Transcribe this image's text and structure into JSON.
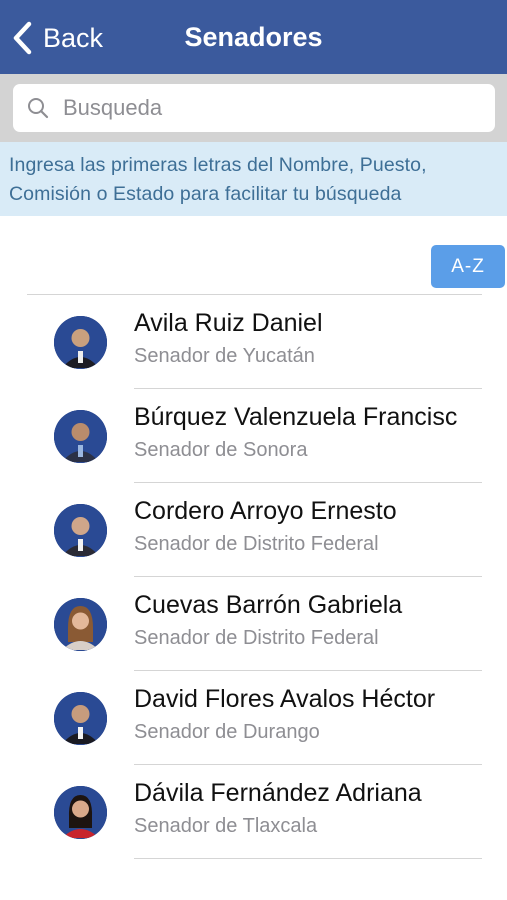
{
  "nav": {
    "back_label": "Back",
    "title": "Senadores",
    "bar_color": "#3b5a9d"
  },
  "search": {
    "placeholder": "Busqueda",
    "value": ""
  },
  "hint": {
    "line1": "Ingresa las primeras letras del Nombre, Puesto,",
    "line2": "Comisión o Estado para facilitar tu búsqueda"
  },
  "sort": {
    "label": "A-Z",
    "color": "#5b9ee8"
  },
  "senators": [
    {
      "name": "Avila Ruiz Daniel",
      "subtitle": "Senador de Yucatán"
    },
    {
      "name": "Búrquez Valenzuela Francisco",
      "subtitle": "Senador de Sonora"
    },
    {
      "name": "Cordero Arroyo Ernesto",
      "subtitle": "Senador de Distrito Federal"
    },
    {
      "name": "Cuevas Barrón Gabriela",
      "subtitle": "Senador de Distrito Federal"
    },
    {
      "name": "David Flores Avalos Héctor",
      "subtitle": "Senador de Durango"
    },
    {
      "name": "Dávila Fernández Adriana",
      "subtitle": "Senador de Tlaxcala"
    }
  ]
}
